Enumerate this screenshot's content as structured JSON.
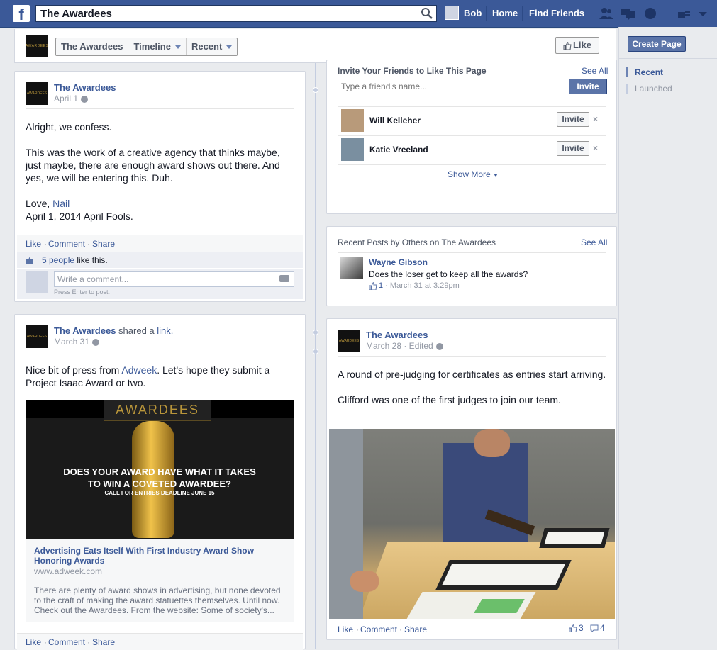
{
  "topbar": {
    "logo": "f",
    "search_value": "The Awardees",
    "user_name": "Bob",
    "home": "Home",
    "find_friends": "Find Friends"
  },
  "page_header": {
    "thumb_text": "AWARDEES",
    "page_name_btn": "The Awardees",
    "timeline_btn": "Timeline",
    "recent_btn": "Recent",
    "like_btn": "Like"
  },
  "right_rail": {
    "create_page": "Create Page",
    "items": [
      {
        "label": "Recent",
        "active": true
      },
      {
        "label": "Launched",
        "active": false
      }
    ]
  },
  "post1": {
    "author": "The Awardees",
    "date": "April 1",
    "paragraphs": [
      "Alright, we confess.",
      "This was the work of a creative agency that thinks maybe, just maybe, there are enough award shows out there. And yes, we will be entering this. Duh."
    ],
    "sign_prefix": "Love, ",
    "sign_link": "Nail",
    "sign_date": "April 1, 2014 April Fools.",
    "actions": {
      "like": "Like",
      "comment": "Comment",
      "share": "Share"
    },
    "likes_link": "5 people",
    "likes_suffix": " like this.",
    "comment_placeholder": "Write a comment...",
    "press_enter": "Press Enter to post."
  },
  "post2": {
    "author": "The Awardees",
    "shared": " shared a ",
    "shared_link": "link.",
    "date": "March 31",
    "text_pre": "Nice bit of press from ",
    "text_link": "Adweek",
    "text_post": ". Let's hope they submit a Project Isaac Award or two.",
    "image": {
      "banner": "AWARDEES",
      "headline1": "DOES YOUR AWARD HAVE WHAT IT TAKES",
      "headline2": "TO WIN A COVETED AWARDEE?",
      "sub": "CALL FOR ENTRIES DEADLINE JUNE 15"
    },
    "link_title": "Advertising Eats Itself With First Industry Award Show Honoring Awards",
    "link_domain": "www.adweek.com",
    "link_desc": "There are plenty of award shows in advertising, but none devoted to the craft of making the award statuettes themselves. Until now. Check out the Awardees. From the website: Some of society's...",
    "actions": {
      "like": "Like",
      "comment": "Comment",
      "share": "Share"
    }
  },
  "invite": {
    "title": "Invite Your Friends to Like This Page",
    "see_all": "See All",
    "placeholder": "Type a friend's name...",
    "invite_btn": "Invite",
    "friends": [
      {
        "name": "Will Kelleher",
        "btn": "Invite",
        "color": "#b89a7a"
      },
      {
        "name": "Katie Vreeland",
        "btn": "Invite",
        "color": "#7a8fa0"
      }
    ],
    "show_more": "Show More"
  },
  "recent_posts": {
    "title": "Recent Posts by Others on The Awardees",
    "see_all": "See All",
    "author": "Wayne Gibson",
    "text": "Does the loser get to keep all the awards?",
    "likes": "1",
    "date": "March 31 at 3:29pm"
  },
  "post3": {
    "author": "The Awardees",
    "date": "March 28 · Edited",
    "paragraphs": [
      "A round of pre-judging for certificates as entries start arriving.",
      "Clifford was one of the first judges to join our team."
    ],
    "actions": {
      "like": "Like",
      "comment": "Comment",
      "share": "Share"
    },
    "like_count": "3",
    "comment_count": "4"
  },
  "colors": {
    "brand_blue": "#3b5998",
    "link": "#3b5998",
    "meta_gray": "#9197a3",
    "bg": "#e9ebee"
  }
}
